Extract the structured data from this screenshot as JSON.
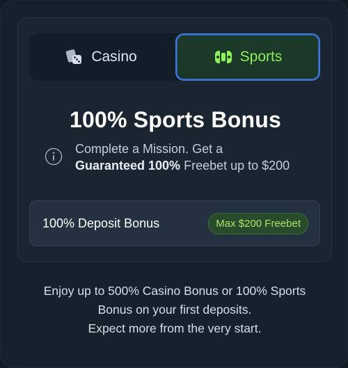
{
  "tabs": {
    "casino": {
      "label": "Casino",
      "icon": "dice-cards-icon",
      "selected": false
    },
    "sports": {
      "label": "Sports",
      "icon": "controller-icon",
      "selected": true
    }
  },
  "bonus": {
    "headline": "100% Sports Bonus",
    "info_line1": "Complete a Mission. Get a",
    "info_bold": "Guaranteed 100%",
    "info_line2_rest": " Freebet up to $200",
    "info_icon": "info-icon"
  },
  "deposit": {
    "label": "100% Deposit Bonus",
    "badge": "Max $200 Freebet"
  },
  "footer": {
    "line1": "Enjoy up to 500% Casino Bonus or 100% Sports",
    "line2": "Bonus on your first deposits.",
    "line3": "Expect more from the very start."
  },
  "colors": {
    "accent_green": "#8ef05a",
    "selected_border": "#3f7bd6",
    "badge_text": "#a6e56b",
    "background": "#16212c"
  }
}
